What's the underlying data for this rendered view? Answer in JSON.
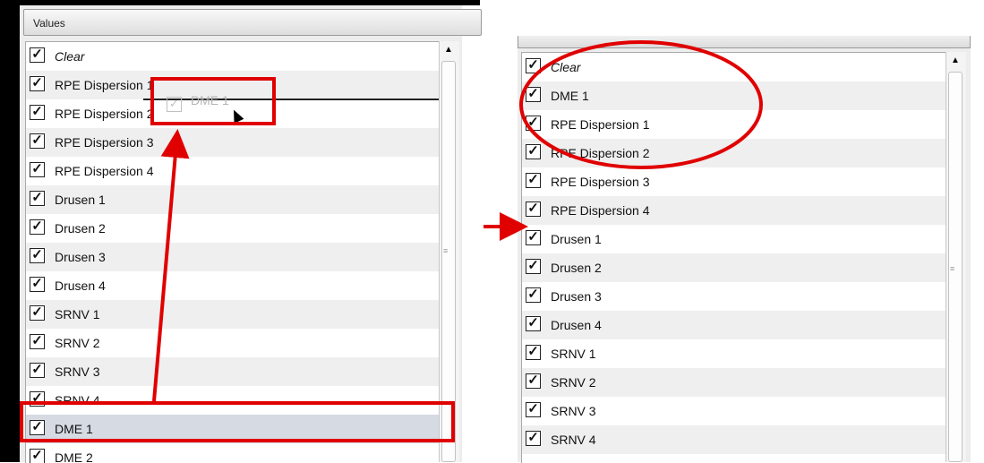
{
  "left_panel": {
    "header": "Values",
    "items": [
      {
        "label": "Clear",
        "checked": true,
        "italic": true
      },
      {
        "label": "RPE Dispersion 1",
        "checked": true
      },
      {
        "label": "RPE Dispersion 2",
        "checked": true
      },
      {
        "label": "RPE Dispersion 3",
        "checked": true
      },
      {
        "label": "RPE Dispersion 4",
        "checked": true
      },
      {
        "label": "Drusen 1",
        "checked": true
      },
      {
        "label": "Drusen 2",
        "checked": true
      },
      {
        "label": "Drusen 3",
        "checked": true
      },
      {
        "label": "Drusen 4",
        "checked": true
      },
      {
        "label": "SRNV 1",
        "checked": true
      },
      {
        "label": "SRNV 2",
        "checked": true
      },
      {
        "label": "SRNV 3",
        "checked": true
      },
      {
        "label": "SRNV 4",
        "checked": true
      },
      {
        "label": "DME 1",
        "checked": true,
        "selected": true
      },
      {
        "label": "DME 2",
        "checked": true
      }
    ],
    "drag_ghost_label": "DME 1"
  },
  "right_panel": {
    "items": [
      {
        "label": "Clear",
        "checked": true,
        "italic": true
      },
      {
        "label": "DME 1",
        "checked": true
      },
      {
        "label": "RPE Dispersion 1",
        "checked": true
      },
      {
        "label": "RPE Dispersion 2",
        "checked": true
      },
      {
        "label": "RPE Dispersion 3",
        "checked": true
      },
      {
        "label": "RPE Dispersion 4",
        "checked": true
      },
      {
        "label": "Drusen 1",
        "checked": true
      },
      {
        "label": "Drusen 2",
        "checked": true
      },
      {
        "label": "Drusen 3",
        "checked": true
      },
      {
        "label": "Drusen 4",
        "checked": true
      },
      {
        "label": "SRNV 1",
        "checked": true
      },
      {
        "label": "SRNV 2",
        "checked": true
      },
      {
        "label": "SRNV 3",
        "checked": true
      },
      {
        "label": "SRNV 4",
        "checked": true
      }
    ]
  },
  "icons": {
    "checkmark": "check-icon",
    "scroll_up": "arrow-up-icon",
    "cursor": "mouse-pointer-icon"
  },
  "colors": {
    "annotation_red": "#e00000",
    "selected_row": "#d5dae3",
    "alt_row": "#efefef"
  }
}
